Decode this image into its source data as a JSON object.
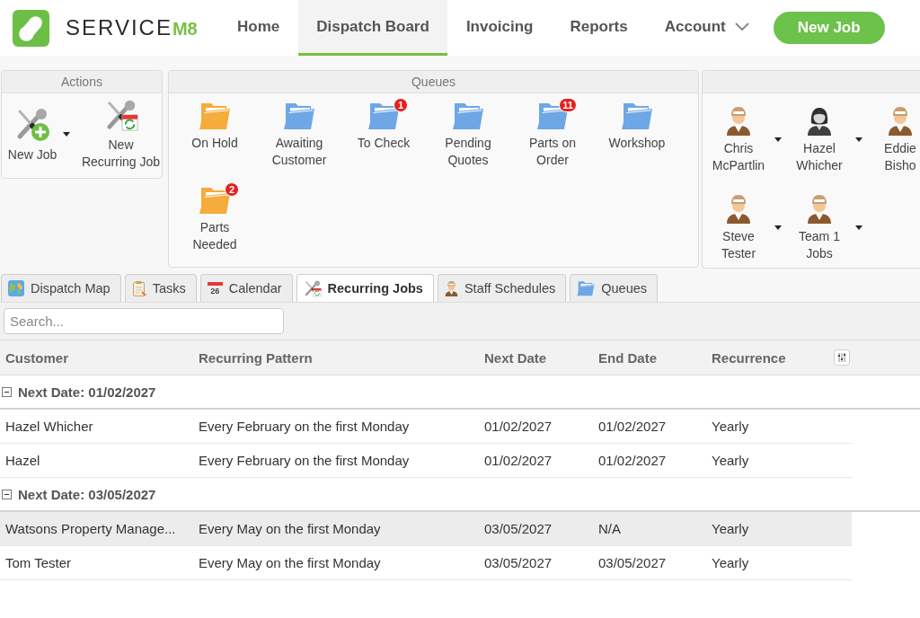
{
  "header": {
    "logo": {
      "word": "SERVICE",
      "suffix": "M8"
    },
    "nav": [
      {
        "label": "Home",
        "selected": false,
        "menu": false
      },
      {
        "label": "Dispatch Board",
        "selected": true,
        "menu": false
      },
      {
        "label": "Invoicing",
        "selected": false,
        "menu": false
      },
      {
        "label": "Reports",
        "selected": false,
        "menu": false
      },
      {
        "label": "Account",
        "selected": false,
        "menu": true
      }
    ],
    "new_job_button": "New Job"
  },
  "actions": {
    "title": "Actions",
    "items": [
      {
        "label": "New Job",
        "kind": "new-job",
        "menu": true
      },
      {
        "label": "New Recurring Job",
        "kind": "recurring",
        "menu": false
      }
    ]
  },
  "queues": {
    "title": "Queues",
    "items": [
      {
        "label": "On Hold",
        "color": "#f5ac3b"
      },
      {
        "label": "Awaiting Customer",
        "color": "#6ea7e6"
      },
      {
        "label": "To Check",
        "color": "#6ea7e6",
        "badge": "1"
      },
      {
        "label": "Pending Quotes",
        "color": "#6ea7e6"
      },
      {
        "label": "Parts on Order",
        "color": "#6ea7e6",
        "badge": "11"
      },
      {
        "label": "Workshop",
        "color": "#6ea7e6"
      },
      {
        "label": "Parts Needed",
        "color": "#f5ac3b",
        "badge": "2"
      }
    ]
  },
  "staff": {
    "items": [
      {
        "name": "Chris McPartlin",
        "kind": "worker",
        "menu": true
      },
      {
        "name": "Hazel Whicher",
        "kind": "woman",
        "menu": true
      },
      {
        "name": "Eddie Bisho",
        "kind": "worker"
      },
      {
        "name": "Steve Tester",
        "kind": "worker",
        "menu": true
      },
      {
        "name": "Team 1 Jobs",
        "kind": "worker",
        "menu": true
      }
    ]
  },
  "tabs": [
    {
      "label": "Dispatch Map",
      "kind": "map",
      "selected": false
    },
    {
      "label": "Tasks",
      "kind": "tasks",
      "selected": false
    },
    {
      "label": "Calendar",
      "kind": "calendar",
      "icon_text": "26",
      "selected": false
    },
    {
      "label": "Recurring Jobs",
      "kind": "tools",
      "selected": true
    },
    {
      "label": "Staff Schedules",
      "kind": "person",
      "selected": false
    },
    {
      "label": "Queues",
      "kind": "folder",
      "selected": false
    }
  ],
  "search": {
    "placeholder": "Search..."
  },
  "table": {
    "columns": [
      "Customer",
      "Recurring Pattern",
      "Next Date",
      "End Date",
      "Recurrence"
    ],
    "groups": [
      {
        "label": "Next Date: 01/02/2027",
        "expanded": true,
        "rows": [
          {
            "cells": [
              "Hazel Whicher",
              "Every February on the first Monday",
              "01/02/2027",
              "01/02/2027",
              "Yearly"
            ],
            "selected": false
          },
          {
            "cells": [
              "Hazel",
              "Every February on the first Monday",
              "01/02/2027",
              "01/02/2027",
              "Yearly"
            ],
            "selected": false
          }
        ]
      },
      {
        "label": "Next Date: 03/05/2027",
        "expanded": true,
        "rows": [
          {
            "cells": [
              "Watsons Property Manage...",
              "Every May on the first Monday",
              "03/05/2027",
              "N/A",
              "Yearly"
            ],
            "selected": true
          },
          {
            "cells": [
              "Tom Tester",
              "Every May on the first Monday",
              "03/05/2027",
              "03/05/2027",
              "Yearly"
            ],
            "selected": false
          }
        ]
      }
    ]
  }
}
